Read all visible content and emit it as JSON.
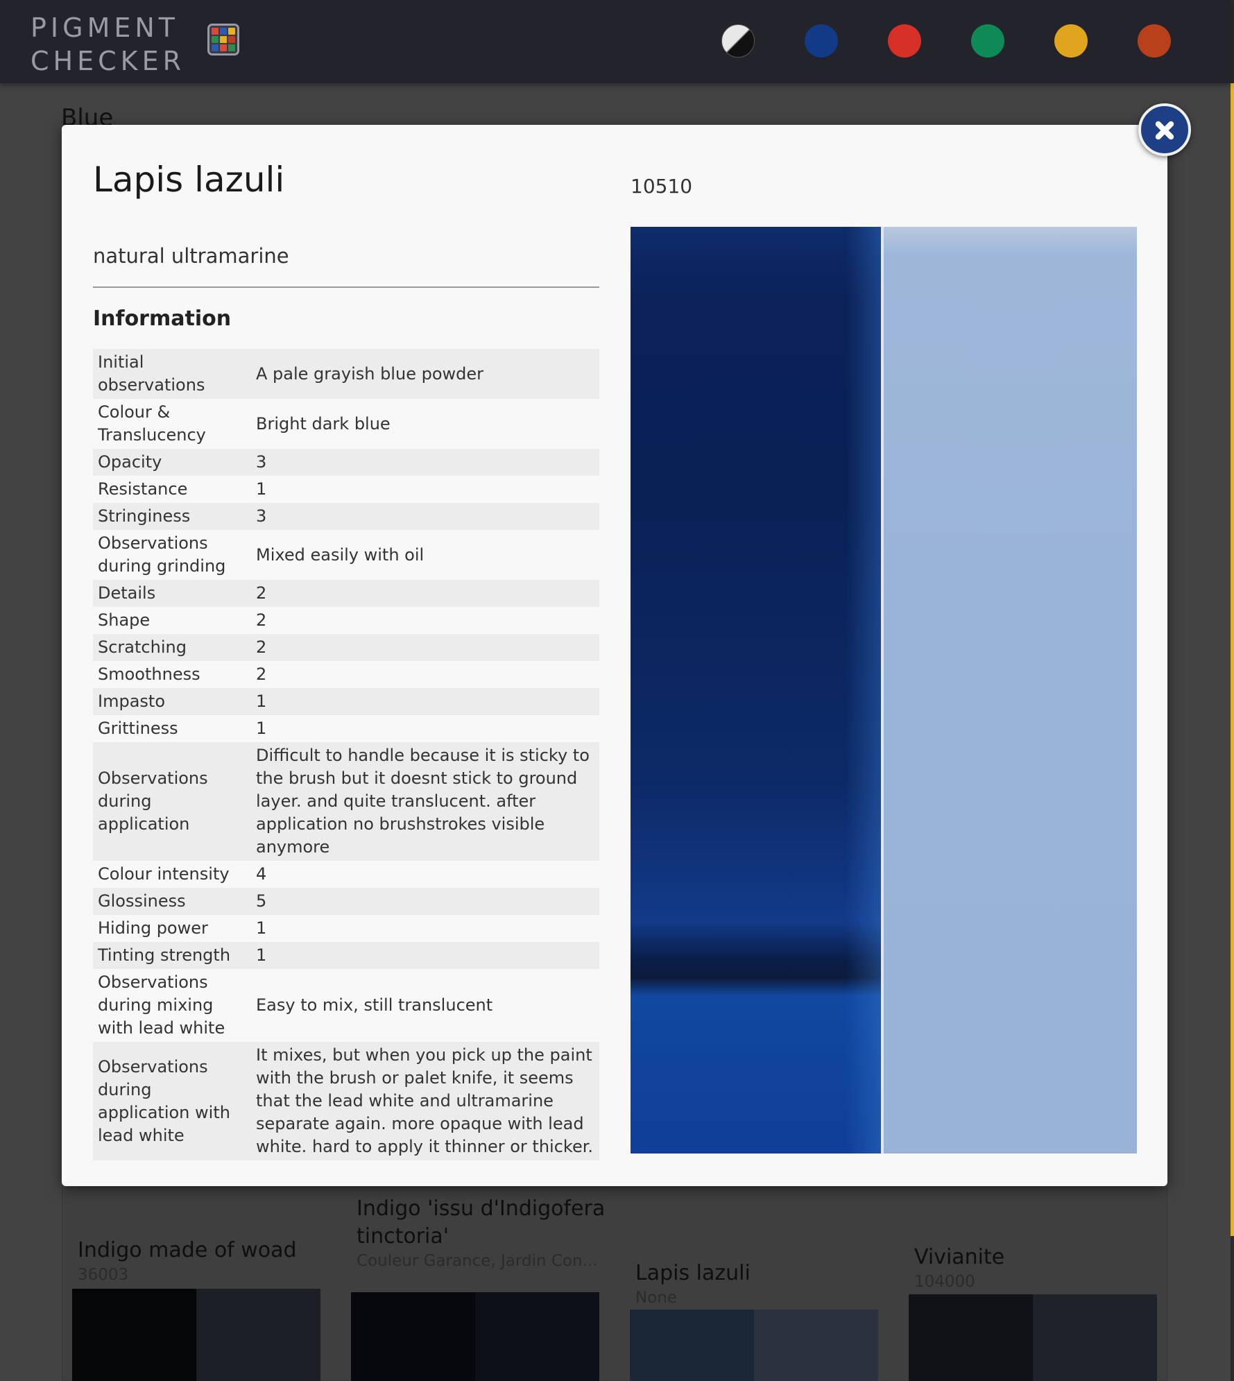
{
  "app": {
    "logo_line1": "PIGMENT",
    "logo_line2": "CHECKER",
    "logo_icon": "color-grid-icon",
    "swatches": [
      {
        "name": "black-white",
        "color": "#111111/#e8e8e8"
      },
      {
        "name": "blue",
        "color": "#133a86"
      },
      {
        "name": "red",
        "color": "#d73027"
      },
      {
        "name": "green",
        "color": "#0e8a57"
      },
      {
        "name": "yellow",
        "color": "#e0a51c"
      },
      {
        "name": "brown",
        "color": "#b8401a"
      }
    ]
  },
  "page": {
    "section_title": "Blue",
    "cards": [
      {
        "title": "Indigo made of woad",
        "subtitle": "36003"
      },
      {
        "title": "Indigo 'issu d'Indigofera tinctoria'",
        "subtitle": "Couleur Garance, Jardin Con..."
      },
      {
        "title": "Lapis lazuli",
        "subtitle": "None"
      },
      {
        "title": "Vivianite",
        "subtitle": "104000"
      }
    ]
  },
  "modal": {
    "name": "Lapis lazuli",
    "alt_name": "natural ultramarine",
    "code": "10510",
    "info_heading": "Information",
    "close_icon": "close-icon",
    "rows": [
      {
        "label": "Initial observations",
        "value": "A pale grayish blue powder"
      },
      {
        "label": "Colour & Translucency",
        "value": "Bright dark blue"
      },
      {
        "label": "Opacity",
        "value": "3"
      },
      {
        "label": "Resistance",
        "value": "1"
      },
      {
        "label": "Stringiness",
        "value": "3"
      },
      {
        "label": "Observations during grinding",
        "value": "Mixed easily with oil"
      },
      {
        "label": "Details",
        "value": "2"
      },
      {
        "label": "Shape",
        "value": "2"
      },
      {
        "label": "Scratching",
        "value": "2"
      },
      {
        "label": "Smoothness",
        "value": "2"
      },
      {
        "label": "Impasto",
        "value": "1"
      },
      {
        "label": "Grittiness",
        "value": "1"
      },
      {
        "label": "Observations during application",
        "value": "Difficult to handle because it is sticky to the brush but it doesnt stick to ground layer. and quite translucent. after application no brushstrokes visible anymore"
      },
      {
        "label": "Colour intensity",
        "value": "4"
      },
      {
        "label": "Glossiness",
        "value": "5"
      },
      {
        "label": "Hiding power",
        "value": "1"
      },
      {
        "label": "Tinting strength",
        "value": "1"
      },
      {
        "label": "Observations during mixing with lead white",
        "value": "Easy to mix, still translucent"
      },
      {
        "label": "Observations during application with lead white",
        "value": "It mixes, but when you pick up the paint with the brush or palet knife, it seems that the lead white and ultramarine separate again. more opaque with lead white. hard to apply it thinner or thicker."
      }
    ]
  }
}
